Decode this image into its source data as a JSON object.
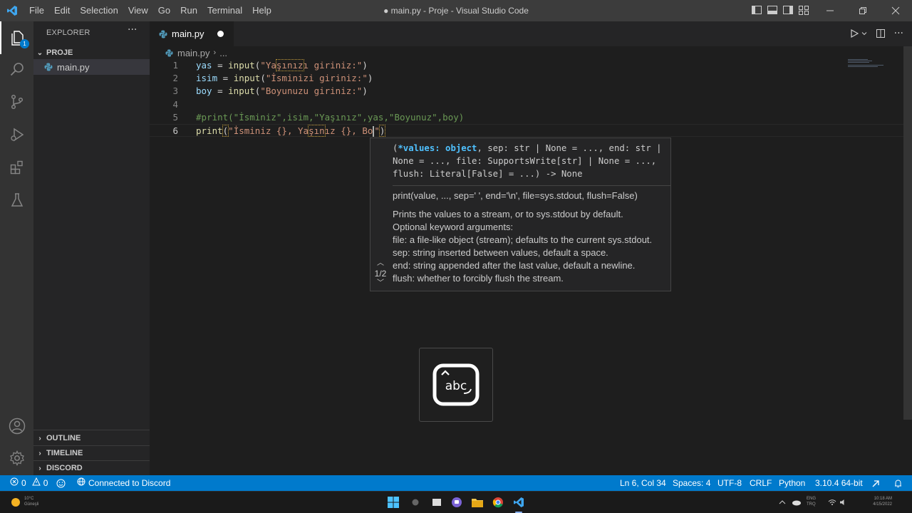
{
  "window": {
    "title": "● main.py - Proje - Visual Studio Code",
    "menu": [
      "File",
      "Edit",
      "Selection",
      "View",
      "Go",
      "Run",
      "Terminal",
      "Help"
    ]
  },
  "activity_bar": {
    "explorer_badge": "1",
    "items": [
      "explorer-icon",
      "search-icon",
      "source-control-icon",
      "run-debug-icon",
      "extensions-icon",
      "testing-icon",
      "accounts-icon",
      "settings-gear-icon"
    ]
  },
  "sidebar": {
    "title": "EXPLORER",
    "more": "···",
    "folder": "PROJE",
    "files": [
      "main.py"
    ],
    "sections": [
      "OUTLINE",
      "TIMELINE",
      "DISCORD"
    ]
  },
  "editor": {
    "tab_label": "main.py",
    "breadcrumb": {
      "file": "main.py",
      "more": "..."
    },
    "lines": [
      {
        "n": "1",
        "parts": [
          [
            "v",
            "yas"
          ],
          [
            "p",
            " = "
          ],
          [
            "f",
            "input"
          ],
          [
            "p",
            "("
          ],
          [
            "s",
            "\"Ya"
          ],
          [
            "sh",
            "şınız"
          ],
          [
            "s",
            "ı giriniz:\""
          ],
          [
            "p",
            ")"
          ]
        ]
      },
      {
        "n": "2",
        "parts": [
          [
            "v",
            "isim"
          ],
          [
            "p",
            " = "
          ],
          [
            "f",
            "input"
          ],
          [
            "p",
            "("
          ],
          [
            "s",
            "\"İsminizi giriniz:\""
          ],
          [
            "p",
            ")"
          ]
        ]
      },
      {
        "n": "3",
        "parts": [
          [
            "v",
            "boy"
          ],
          [
            "p",
            " = "
          ],
          [
            "f",
            "input"
          ],
          [
            "p",
            "("
          ],
          [
            "s",
            "\"Boyunuzu giriniz:\""
          ],
          [
            "p",
            ")"
          ]
        ]
      },
      {
        "n": "4",
        "parts": []
      },
      {
        "n": "5",
        "parts": [
          [
            "c",
            "#print(\"İsminiz\",isim,\"Yaşınız\",yas,\"Boyunuz\",boy)"
          ]
        ]
      },
      {
        "n": "6",
        "parts": [
          [
            "f",
            "print"
          ],
          [
            "ph",
            "("
          ],
          [
            "s",
            "\"İsminiz {}, Ya"
          ],
          [
            "sh",
            "şın"
          ],
          [
            "s",
            "ız {}, Bo"
          ],
          [
            "cur",
            ""
          ],
          [
            "sp",
            "\""
          ],
          [
            "ph",
            ")"
          ]
        ]
      }
    ]
  },
  "signature_help": {
    "signature_active": "*values: object",
    "signature_before": "(",
    "signature_after": ", sep: str | None = ..., end: str | None = ..., file: SupportsWrite[str] | None = ..., flush: Literal[False] = ...) -> None",
    "doc_signature": "print(value, ..., sep=' ', end='\\n', file=sys.stdout, flush=False)",
    "doc_lines": [
      "Prints the values to a stream, or to sys.stdout by default.",
      "Optional keyword arguments:",
      "file: a file-like object (stream); defaults to the current sys.stdout.",
      "sep: string inserted between values, default a space.",
      "end: string appended after the last value, default a newline.",
      "flush: whether to forcibly flush the stream."
    ],
    "counter": "1/2"
  },
  "key_overlay": {
    "text": "abc"
  },
  "status_bar": {
    "errors": "0",
    "warnings": "0",
    "discord": "Connected to Discord",
    "position": "Ln 6, Col 34",
    "spaces": "Spaces: 4",
    "encoding": "UTF-8",
    "eol": "CRLF",
    "language": "Python",
    "interpreter": "3.10.4 64-bit"
  },
  "taskbar": {
    "weather_line1": "10°C",
    "weather_line2": "Güneşli",
    "lang_line1": "ENG",
    "lang_line2": "TRQ",
    "clock_time": "10:18 AM",
    "clock_date": "4/15/2022"
  },
  "colors": {
    "statusbar": "#007acc",
    "activity_bar": "#333333",
    "sidebar": "#252526",
    "editor": "#1e1e1e",
    "titlebar": "#3c3c3c"
  }
}
